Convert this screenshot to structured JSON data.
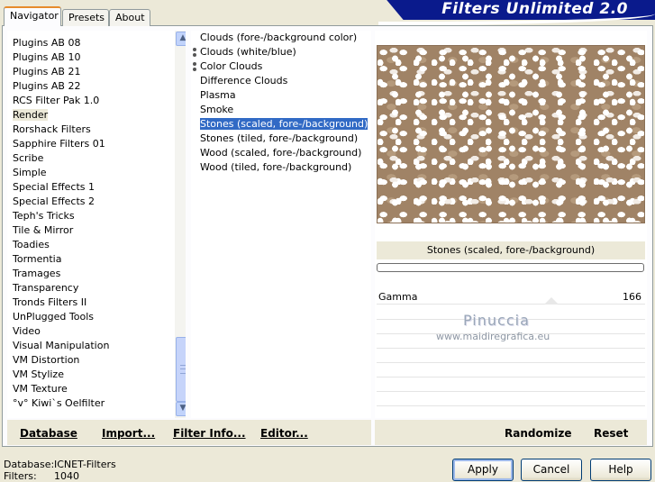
{
  "banner": {
    "title": "Filters Unlimited 2.0"
  },
  "tabs": [
    {
      "label": "Navigator",
      "active": true
    },
    {
      "label": "Presets",
      "active": false
    },
    {
      "label": "About",
      "active": false
    }
  ],
  "categories": {
    "selected": "Render",
    "items": [
      "Plugins AB 08",
      "Plugins AB 10",
      "Plugins AB 21",
      "Plugins AB 22",
      "RCS Filter Pak 1.0",
      "Render",
      "Rorshack Filters",
      "Sapphire Filters 01",
      "Scribe",
      "Simple",
      "Special Effects 1",
      "Special Effects 2",
      "Teph's Tricks",
      "Tile & Mirror",
      "Toadies",
      "Tormentia",
      "Tramages",
      "Transparency",
      "Tronds Filters II",
      "UnPlugged Tools",
      "Video",
      "Visual Manipulation",
      "VM Distortion",
      "VM Stylize",
      "VM Texture",
      "°v° Kiwi`s Oelfilter"
    ]
  },
  "filters": {
    "selected": "Stones (scaled, fore-/background)",
    "items": [
      {
        "label": "Clouds (fore-/background color)",
        "marker": false
      },
      {
        "label": "Clouds (white/blue)",
        "marker": true
      },
      {
        "label": "Color Clouds",
        "marker": true
      },
      {
        "label": "Difference Clouds",
        "marker": false
      },
      {
        "label": "Plasma",
        "marker": false
      },
      {
        "label": "Smoke",
        "marker": false
      },
      {
        "label": "Stones (scaled, fore-/background)",
        "marker": false
      },
      {
        "label": "Stones (tiled, fore-/background)",
        "marker": false
      },
      {
        "label": "Wood (scaled, fore-/background)",
        "marker": false
      },
      {
        "label": "Wood (tiled, fore-/background)",
        "marker": false
      }
    ]
  },
  "preview": {
    "filter_name": "Stones (scaled, fore-/background)",
    "colors": {
      "stone": "#a08366",
      "mortar": "#ffffff"
    }
  },
  "params": [
    {
      "name": "Gamma",
      "value": "166"
    }
  ],
  "watermark": {
    "line1": "Pinuccia",
    "line2": "www.maidiregrafica.eu"
  },
  "left_buttons": {
    "database": "Database",
    "import": "Import...",
    "filter_info": "Filter Info...",
    "editor": "Editor..."
  },
  "right_buttons": {
    "randomize": "Randomize",
    "reset": "Reset"
  },
  "status": {
    "database_label": "Database:",
    "database_value": "ICNET-Filters",
    "filters_label": "Filters:",
    "filters_value": "1040"
  },
  "dialog_buttons": {
    "apply": "Apply",
    "cancel": "Cancel",
    "help": "Help"
  },
  "scrollbar": {
    "up_icon": "chevron-up-icon",
    "down_icon": "chevron-down-icon",
    "position_fraction": 0.95
  }
}
